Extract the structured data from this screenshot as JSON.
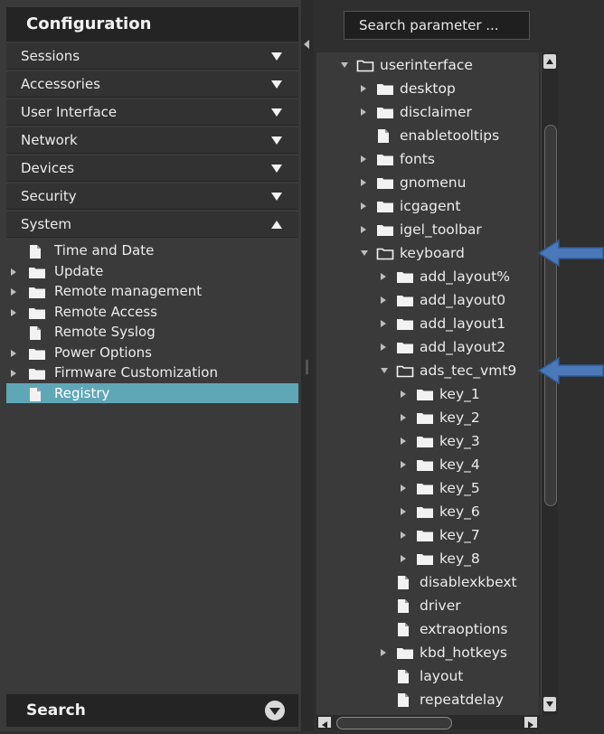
{
  "left": {
    "title": "Configuration",
    "sections": [
      {
        "label": "Sessions",
        "state": "collapsed"
      },
      {
        "label": "Accessories",
        "state": "collapsed"
      },
      {
        "label": "User Interface",
        "state": "collapsed"
      },
      {
        "label": "Network",
        "state": "collapsed"
      },
      {
        "label": "Devices",
        "state": "collapsed"
      },
      {
        "label": "Security",
        "state": "collapsed"
      },
      {
        "label": "System",
        "state": "expanded"
      }
    ],
    "system_items": [
      {
        "label": "Time and Date",
        "type": "file",
        "expandable": false
      },
      {
        "label": "Update",
        "type": "folder",
        "expandable": true
      },
      {
        "label": "Remote management",
        "type": "folder",
        "expandable": true
      },
      {
        "label": "Remote Access",
        "type": "folder",
        "expandable": true
      },
      {
        "label": "Remote Syslog",
        "type": "file",
        "expandable": false
      },
      {
        "label": "Power Options",
        "type": "folder",
        "expandable": true
      },
      {
        "label": "Firmware Customization",
        "type": "folder",
        "expandable": true
      },
      {
        "label": "Registry",
        "type": "file",
        "expandable": false,
        "selected": true
      }
    ],
    "search_label": "Search"
  },
  "right": {
    "search_param_label": "Search parameter ...",
    "tree": [
      {
        "label": "userinterface",
        "depth": 0,
        "type": "folder-open",
        "state": "expanded"
      },
      {
        "label": "desktop",
        "depth": 1,
        "type": "folder",
        "state": "collapsed"
      },
      {
        "label": "disclaimer",
        "depth": 1,
        "type": "folder",
        "state": "collapsed"
      },
      {
        "label": "enabletooltips",
        "depth": 1,
        "type": "file",
        "state": "leaf"
      },
      {
        "label": "fonts",
        "depth": 1,
        "type": "folder",
        "state": "collapsed"
      },
      {
        "label": "gnomenu",
        "depth": 1,
        "type": "folder",
        "state": "collapsed"
      },
      {
        "label": "icgagent",
        "depth": 1,
        "type": "folder",
        "state": "collapsed"
      },
      {
        "label": "igel_toolbar",
        "depth": 1,
        "type": "folder",
        "state": "collapsed"
      },
      {
        "label": "keyboard",
        "depth": 1,
        "type": "folder-open",
        "state": "expanded"
      },
      {
        "label": "add_layout%",
        "depth": 2,
        "type": "folder",
        "state": "collapsed"
      },
      {
        "label": "add_layout0",
        "depth": 2,
        "type": "folder",
        "state": "collapsed"
      },
      {
        "label": "add_layout1",
        "depth": 2,
        "type": "folder",
        "state": "collapsed"
      },
      {
        "label": "add_layout2",
        "depth": 2,
        "type": "folder",
        "state": "collapsed"
      },
      {
        "label": "ads_tec_vmt9",
        "depth": 2,
        "type": "folder-open",
        "state": "expanded"
      },
      {
        "label": "key_1",
        "depth": 3,
        "type": "folder",
        "state": "collapsed"
      },
      {
        "label": "key_2",
        "depth": 3,
        "type": "folder",
        "state": "collapsed"
      },
      {
        "label": "key_3",
        "depth": 3,
        "type": "folder",
        "state": "collapsed"
      },
      {
        "label": "key_4",
        "depth": 3,
        "type": "folder",
        "state": "collapsed"
      },
      {
        "label": "key_5",
        "depth": 3,
        "type": "folder",
        "state": "collapsed"
      },
      {
        "label": "key_6",
        "depth": 3,
        "type": "folder",
        "state": "collapsed"
      },
      {
        "label": "key_7",
        "depth": 3,
        "type": "folder",
        "state": "collapsed"
      },
      {
        "label": "key_8",
        "depth": 3,
        "type": "folder",
        "state": "collapsed"
      },
      {
        "label": "disablexkbext",
        "depth": 2,
        "type": "file",
        "state": "leaf"
      },
      {
        "label": "driver",
        "depth": 2,
        "type": "file",
        "state": "leaf"
      },
      {
        "label": "extraoptions",
        "depth": 2,
        "type": "file",
        "state": "leaf"
      },
      {
        "label": "kbd_hotkeys",
        "depth": 2,
        "type": "folder",
        "state": "collapsed"
      },
      {
        "label": "layout",
        "depth": 2,
        "type": "file",
        "state": "leaf"
      },
      {
        "label": "repeatdelay",
        "depth": 2,
        "type": "file",
        "state": "leaf"
      }
    ],
    "annotations": [
      {
        "target": "keyboard",
        "icon": "arrow-left-icon",
        "color": "#4a78b8"
      },
      {
        "target": "ads_tec_vmt9",
        "icon": "arrow-left-icon",
        "color": "#4a78b8"
      }
    ]
  },
  "colors": {
    "selected": "#5fa7b6",
    "annotation_arrow": "#4a78b8"
  }
}
